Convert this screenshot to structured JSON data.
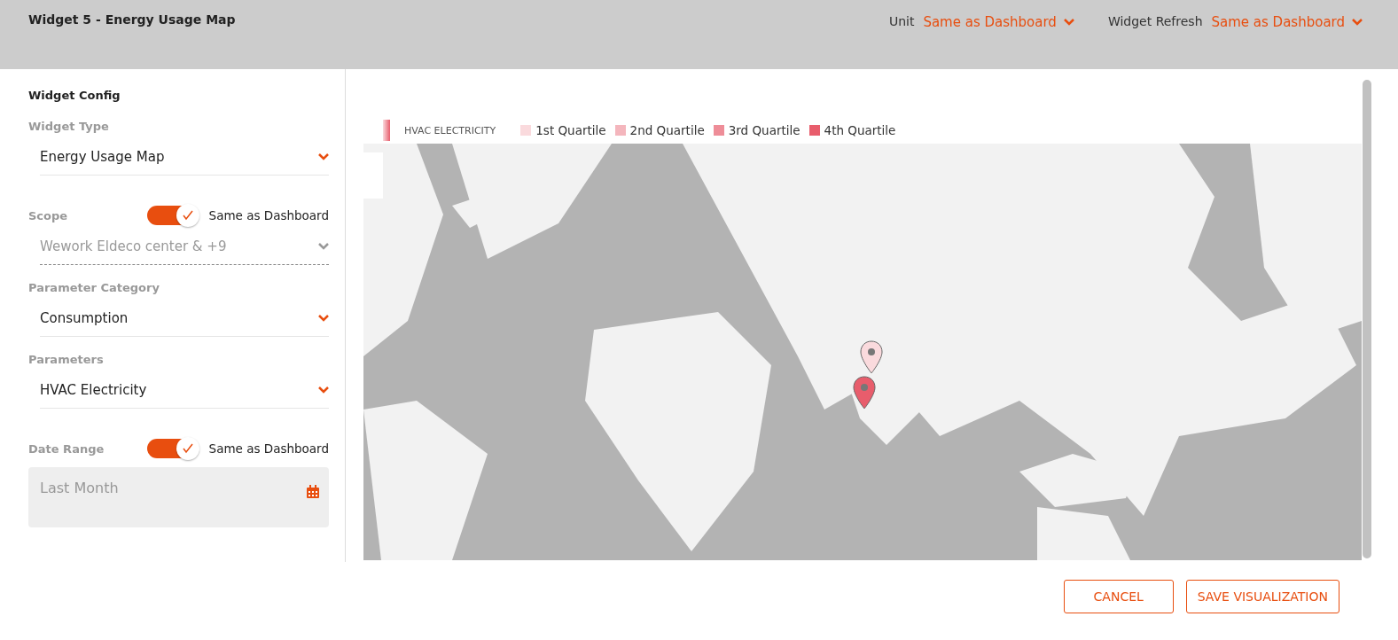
{
  "header": {
    "title": "Widget 5 - Energy Usage Map",
    "selectors": [
      {
        "label": "Unit",
        "value": "Same as Dashboard"
      },
      {
        "label": "Widget Refresh",
        "value": "Same as Dashboard"
      }
    ]
  },
  "config": {
    "title": "Widget Config",
    "fields": [
      {
        "kind": "select",
        "label": "Widget Type",
        "value": "Energy Usage Map",
        "disabled": false
      },
      {
        "kind": "select",
        "label": "Scope",
        "toggle": {
          "label": "Same as Dashboard",
          "on": true
        },
        "value": "Wework Eldeco center & +9",
        "disabled": true
      },
      {
        "kind": "select",
        "label": "Parameter Category",
        "value": "Consumption",
        "disabled": false
      },
      {
        "kind": "select",
        "label": "Parameters",
        "value": "HVAC Electricity",
        "disabled": false
      },
      {
        "kind": "date",
        "label": "Date Range",
        "toggle": {
          "label": "Same as Dashboard",
          "on": true
        },
        "value": "Last Month",
        "disabled": true
      }
    ]
  },
  "map": {
    "series": "HVAC ELECTRICITY",
    "legend": [
      {
        "label": "1st Quartile",
        "color": "#fadadd"
      },
      {
        "label": "2nd Quartile",
        "color": "#f4b6bd"
      },
      {
        "label": "3rd Quartile",
        "color": "#ee8d98"
      },
      {
        "label": "4th Quartile",
        "color": "#e85d6c"
      }
    ],
    "markers": [
      {
        "color": "#fadadd"
      },
      {
        "color": "#e85d6c"
      }
    ]
  },
  "buttons": [
    "CANCEL",
    "SAVE VISUALIZATION"
  ]
}
